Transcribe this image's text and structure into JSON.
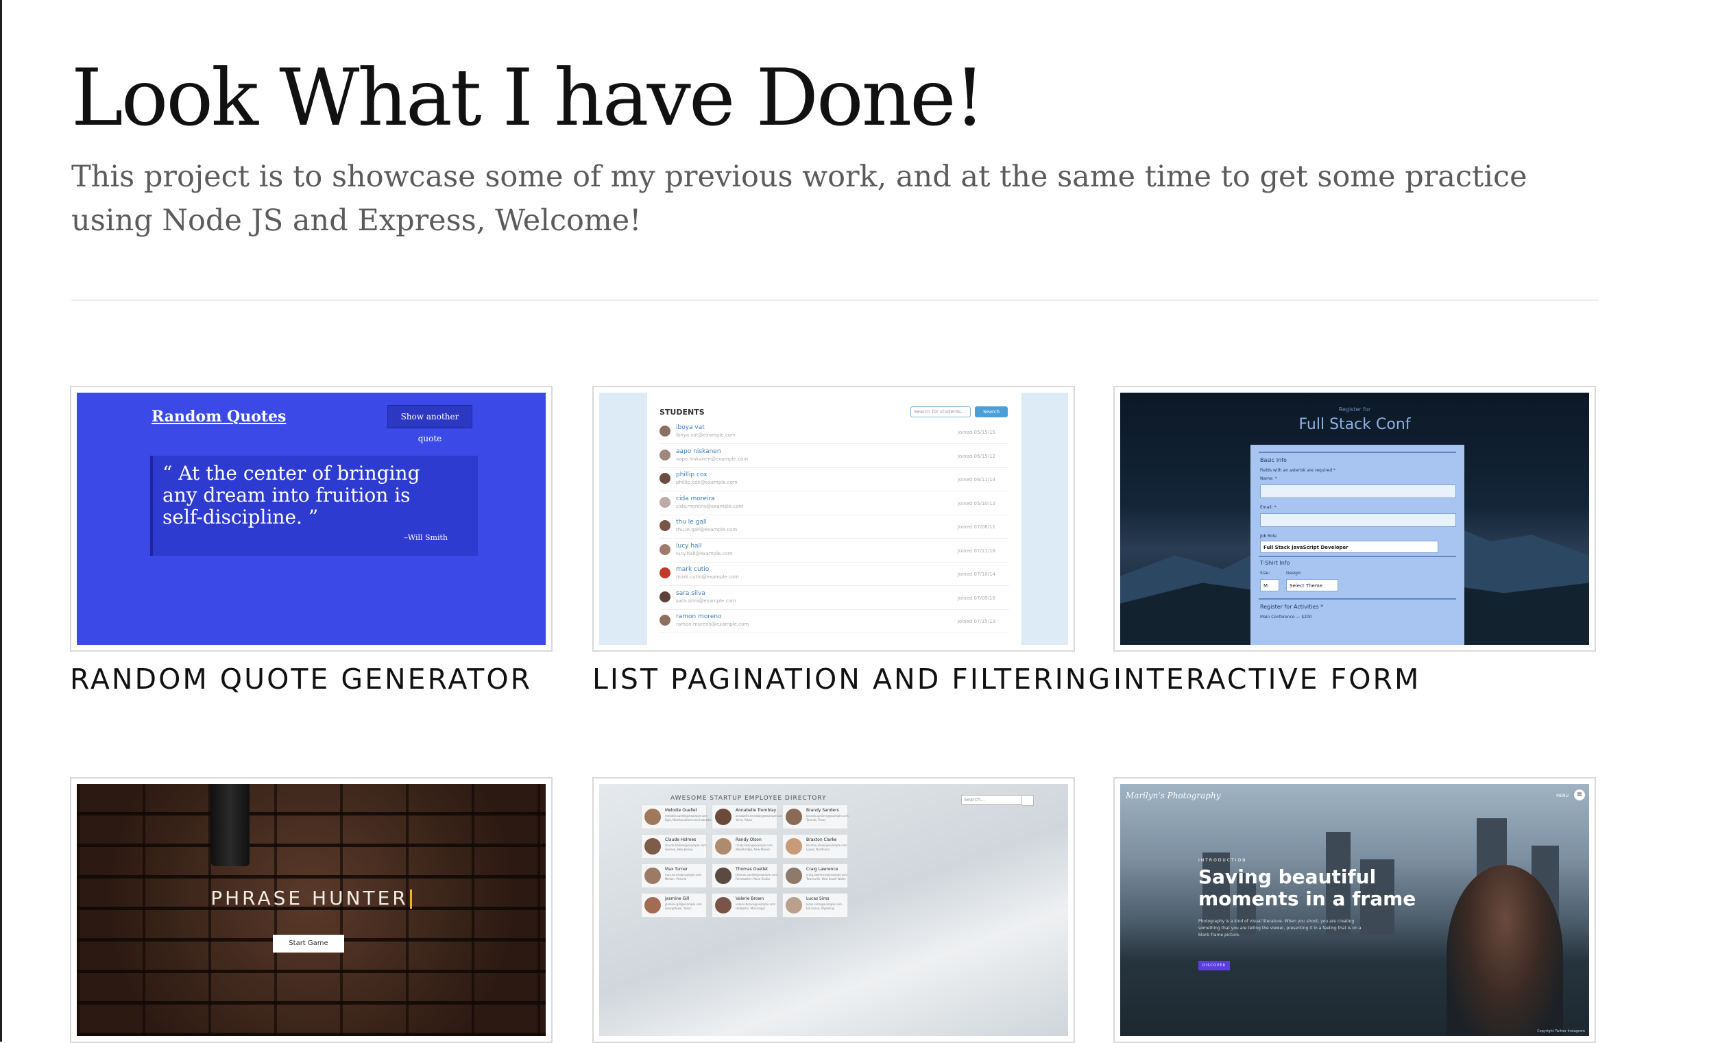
{
  "header": {
    "title": "Look What I have Done!",
    "intro": "This project is to showcase some of my previous work, and at the same time to get some practice using Node JS and Express, Welcome!"
  },
  "projects": [
    {
      "title": "RANDOM QUOTE GENERATOR"
    },
    {
      "title": "LIST PAGINATION AND FILTERING"
    },
    {
      "title": "INTERACTIVE FORM"
    },
    {
      "title": ""
    },
    {
      "title": ""
    },
    {
      "title": ""
    }
  ],
  "thumbs": {
    "quotes": {
      "logo": "Random Quotes",
      "button": "Show another quote",
      "quote": "“ At the center of bringing any dream into fruition is self-discipline. ”",
      "author": "–Will Smith"
    },
    "students": {
      "title": "STUDENTS",
      "search_placeholder": "Search for students...",
      "search_button": "Search",
      "rows": [
        {
          "name": "iboya vat",
          "email": "iboya.vat@example.com",
          "joined": "Joined 05/15/15"
        },
        {
          "name": "aapo niskanen",
          "email": "aapo.niskanen@example.com",
          "joined": "Joined 06/15/12"
        },
        {
          "name": "phillip cox",
          "email": "phillip.cox@example.com",
          "joined": "Joined 08/11/14"
        },
        {
          "name": "cida moreira",
          "email": "cida.moreira@example.com",
          "joined": "Joined 05/10/12"
        },
        {
          "name": "thu le gall",
          "email": "thu.le.gall@example.com",
          "joined": "Joined 07/06/11"
        },
        {
          "name": "lucy hall",
          "email": "lucy.hall@example.com",
          "joined": "Joined 07/11/16"
        },
        {
          "name": "mark cutio",
          "email": "mark.cutio@example.com",
          "joined": "Joined 07/10/14"
        },
        {
          "name": "sara silva",
          "email": "sara.silva@example.com",
          "joined": "Joined 07/09/16"
        },
        {
          "name": "ramon moreno",
          "email": "ramon.moreno@example.com",
          "joined": "Joined 07/15/13"
        }
      ]
    },
    "form": {
      "register": "Register for",
      "title": "Full Stack Conf",
      "basic_info": "Basic Info",
      "required_note": "Fields with an asterisk are required *",
      "name_label": "Name: *",
      "email_label": "Email: *",
      "job_label": "Job Role",
      "job_value": "Full Stack JavaScript Developer",
      "tshirt_label": "T-Shirt Info",
      "size_label": "Size:",
      "size_value": "M",
      "design_label": "Design:",
      "design_value": "Select Theme",
      "activities_label": "Register for Activities *",
      "activity_1": "Main Conference — $200"
    },
    "phrase": {
      "title": "PHRASE HUNTER",
      "button": "Start Game"
    },
    "directory": {
      "title": "AWESOME STARTUP EMPLOYEE DIRECTORY",
      "search_placeholder": "Search...",
      "employees": [
        {
          "name": "Melodie Ouellet",
          "email": "melodie.ouellet@example.com",
          "location": "Egio, Newfoundland and Labrador"
        },
        {
          "name": "Annabelle Tremblay",
          "email": "annabelle.tremblay@example.com",
          "location": "Yarra, Yukon"
        },
        {
          "name": "Brandy Sanders",
          "email": "brandy.sanders@example.com",
          "location": "Toronto, Texas"
        },
        {
          "name": "Claude Holmes",
          "email": "claude.holmes@example.com",
          "location": "Geneva, New Jersey"
        },
        {
          "name": "Randy Olson",
          "email": "randy.olson@example.com",
          "location": "Woodbridge, New Mexico"
        },
        {
          "name": "Braxton Clarke",
          "email": "braxton.clarke@example.com",
          "location": "Lopez, Northland"
        },
        {
          "name": "Max Turner",
          "email": "max.turner@example.com",
          "location": "Nelson, Victoria"
        },
        {
          "name": "Thomas Ouellet",
          "email": "thomas.ouellet@example.com",
          "location": "Fairweather, Nova Scotia"
        },
        {
          "name": "Craig Lawrence",
          "email": "craig.lawrence@example.com",
          "location": "Townsville, New South Wales"
        },
        {
          "name": "Jasmine Gill",
          "email": "jasmine.gill@example.com",
          "location": "Georgetown, Yukon"
        },
        {
          "name": "Valerie Brown",
          "email": "valerie.brown@example.com",
          "location": "Hodgedin, Mississippi"
        },
        {
          "name": "Lucas Sims",
          "email": "lucas.sims@example.com",
          "location": "Elk Grove, Wyoming"
        }
      ]
    },
    "photo": {
      "logo": "Marilyn's Photography",
      "menu": "MENU",
      "intro": "INTRODUCTION",
      "headline": "Saving beautiful moments in a frame",
      "paragraph": "Photography is a kind of visual literature. When you shoot, you are creating something that you are telling the viewer, presenting it in a feeling that is on a blank frame picture.",
      "button": "DISCOVER",
      "footer": "Copyright   Twitter   Instagram"
    }
  },
  "colors": {
    "quotes_bg": "#3b49e6",
    "students_accent": "#4a9fd9",
    "form_panel": "#a7c5f0",
    "phrase_cursor": "#f1b12b",
    "photo_button": "#5a3fe0"
  }
}
